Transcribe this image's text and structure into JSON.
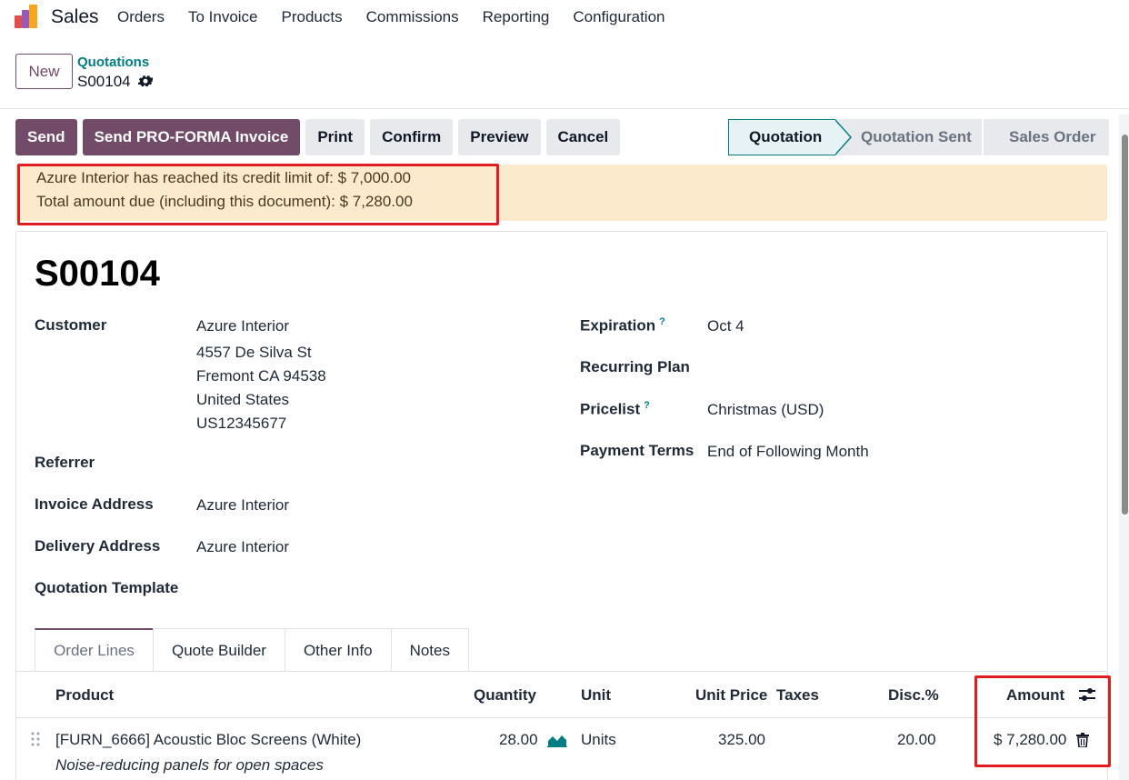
{
  "app": {
    "name": "Sales",
    "menu": [
      "Orders",
      "To Invoice",
      "Products",
      "Commissions",
      "Reporting",
      "Configuration"
    ]
  },
  "control": {
    "new_label": "New",
    "breadcrumb": "Quotations",
    "record": "S00104"
  },
  "actions": {
    "send": "Send",
    "proforma": "Send PRO-FORMA Invoice",
    "print": "Print",
    "confirm": "Confirm",
    "preview": "Preview",
    "cancel": "Cancel"
  },
  "status": {
    "stages": [
      "Quotation",
      "Quotation Sent",
      "Sales Order"
    ],
    "current": "Quotation"
  },
  "alert": {
    "line1": "Azure Interior has reached its credit limit of: $ 7,000.00",
    "line2": "Total amount due (including this document): $ 7,280.00"
  },
  "form": {
    "title": "S00104",
    "customer_label": "Customer",
    "customer_name": "Azure Interior",
    "customer_street": "4557 De Silva St",
    "customer_city": "Fremont CA 94538",
    "customer_country": "United States",
    "customer_vat": "US12345677",
    "referrer_label": "Referrer",
    "invoice_address_label": "Invoice Address",
    "invoice_address": "Azure Interior",
    "delivery_address_label": "Delivery Address",
    "delivery_address": "Azure Interior",
    "template_label": "Quotation Template",
    "expiration_label": "Expiration",
    "expiration": "Oct 4",
    "recurring_label": "Recurring Plan",
    "pricelist_label": "Pricelist",
    "pricelist": "Christmas (USD)",
    "payment_terms_label": "Payment Terms",
    "payment_terms": "End of Following Month",
    "help_mark": "?"
  },
  "tabs": [
    "Order Lines",
    "Quote Builder",
    "Other Info",
    "Notes"
  ],
  "table": {
    "headers": {
      "product": "Product",
      "quantity": "Quantity",
      "unit": "Unit",
      "unit_price": "Unit Price",
      "taxes": "Taxes",
      "disc": "Disc.%",
      "amount": "Amount"
    },
    "rows": [
      {
        "product": "[FURN_6666] Acoustic Bloc Screens (White)",
        "description": "Noise-reducing panels for open spaces",
        "quantity": "28.00",
        "unit": "Units",
        "unit_price": "325.00",
        "taxes": "",
        "disc": "20.00",
        "amount": "$ 7,280.00"
      }
    ]
  },
  "colors": {
    "primary": "#714b67",
    "teal": "#017e84",
    "alert_bg": "#fbeacc",
    "highlight": "#e11d21"
  }
}
